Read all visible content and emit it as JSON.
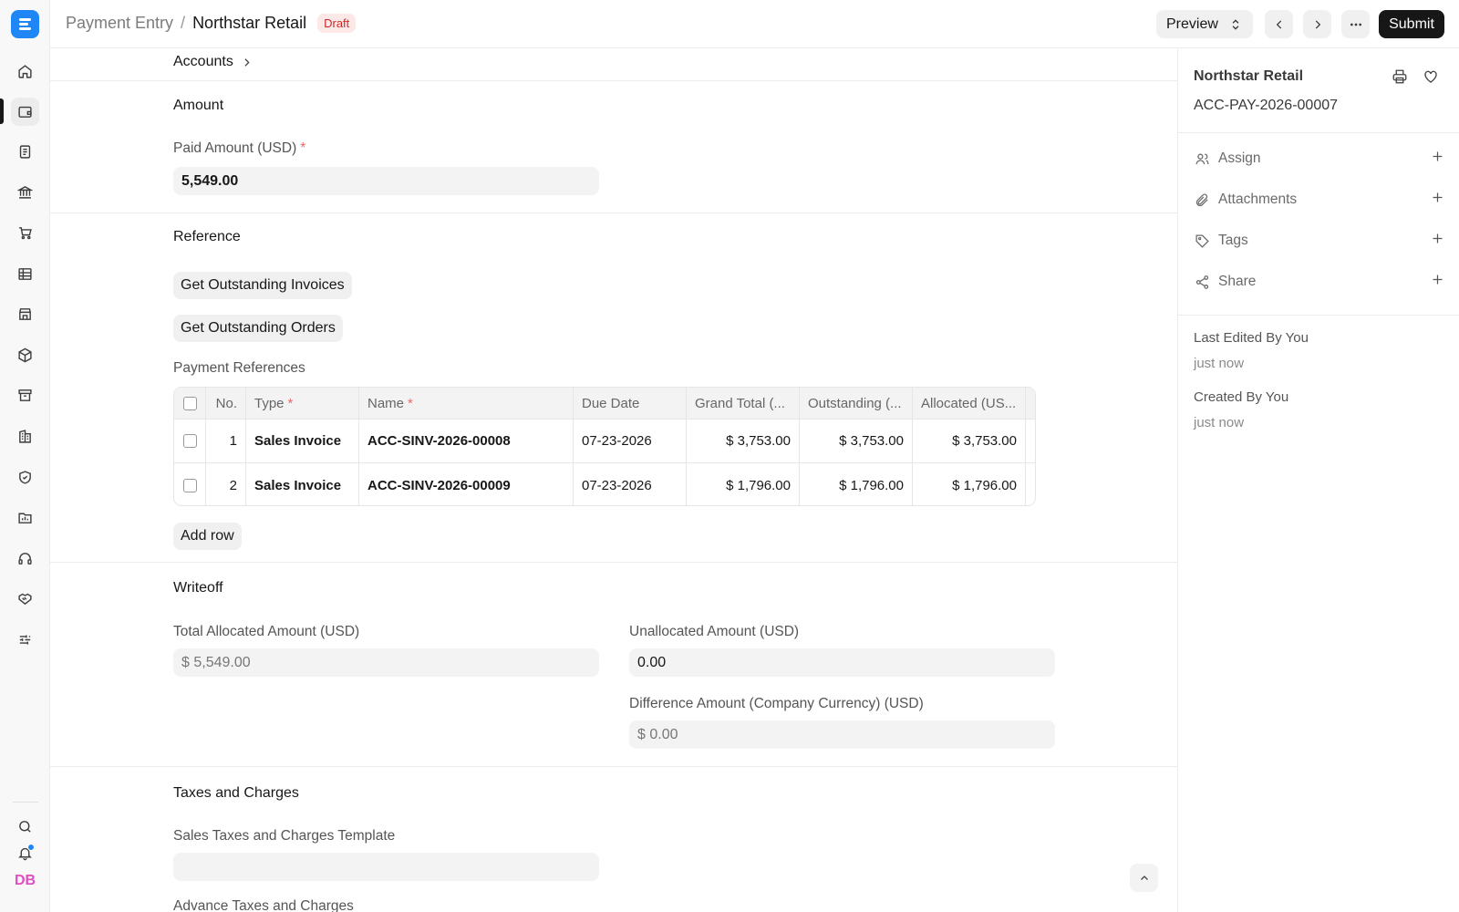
{
  "topbar": {
    "breadcrumb_parent": "Payment Entry",
    "breadcrumb_separator": "/",
    "breadcrumb_current": "Northstar Retail",
    "status_badge": "Draft",
    "preview_label": "Preview",
    "submit_label": "Submit"
  },
  "sidebar": {
    "avatar_initials": "DB",
    "icons": [
      "home-icon",
      "wallet-icon",
      "document-icon",
      "bank-icon",
      "cart-icon",
      "table-icon",
      "store-icon",
      "package-icon",
      "archive-icon",
      "building-icon",
      "shield-icon",
      "folder-chart-icon",
      "headset-icon",
      "handshake-icon",
      "sliders-icon"
    ]
  },
  "accounts": {
    "label": "Accounts"
  },
  "amount": {
    "title": "Amount",
    "paid_amount_label": "Paid Amount (USD)",
    "paid_amount_value": "5,549.00"
  },
  "reference": {
    "title": "Reference",
    "get_invoices_button": "Get Outstanding Invoices",
    "get_orders_button": "Get Outstanding Orders",
    "table_label": "Payment References",
    "columns": {
      "no": "No.",
      "type": "Type",
      "name": "Name",
      "due_date": "Due Date",
      "grand_total": "Grand Total (...",
      "outstanding": "Outstanding (...",
      "allocated": "Allocated (US..."
    },
    "rows": [
      {
        "no": "1",
        "type": "Sales Invoice",
        "name": "ACC-SINV-2026-00008",
        "due_date": "07-23-2026",
        "grand_total": "$ 3,753.00",
        "outstanding": "$ 3,753.00",
        "allocated": "$ 3,753.00"
      },
      {
        "no": "2",
        "type": "Sales Invoice",
        "name": "ACC-SINV-2026-00009",
        "due_date": "07-23-2026",
        "grand_total": "$ 1,796.00",
        "outstanding": "$ 1,796.00",
        "allocated": "$ 1,796.00"
      }
    ],
    "add_row_button": "Add row"
  },
  "writeoff": {
    "title": "Writeoff",
    "total_allocated_label": "Total Allocated Amount (USD)",
    "total_allocated_value": "$ 5,549.00",
    "unallocated_label": "Unallocated Amount (USD)",
    "unallocated_value": "0.00",
    "difference_label": "Difference Amount (Company Currency) (USD)",
    "difference_value": "$ 0.00"
  },
  "taxes": {
    "title": "Taxes and Charges",
    "template_label": "Sales Taxes and Charges Template",
    "template_value": "",
    "advance_label": "Advance Taxes and Charges"
  },
  "panel": {
    "title": "Northstar Retail",
    "doc_id": "ACC-PAY-2026-00007",
    "assign_label": "Assign",
    "attachments_label": "Attachments",
    "tags_label": "Tags",
    "share_label": "Share",
    "last_edited_label": "Last Edited By You",
    "last_edited_time": "just now",
    "created_label": "Created By You",
    "created_time": "just now"
  }
}
